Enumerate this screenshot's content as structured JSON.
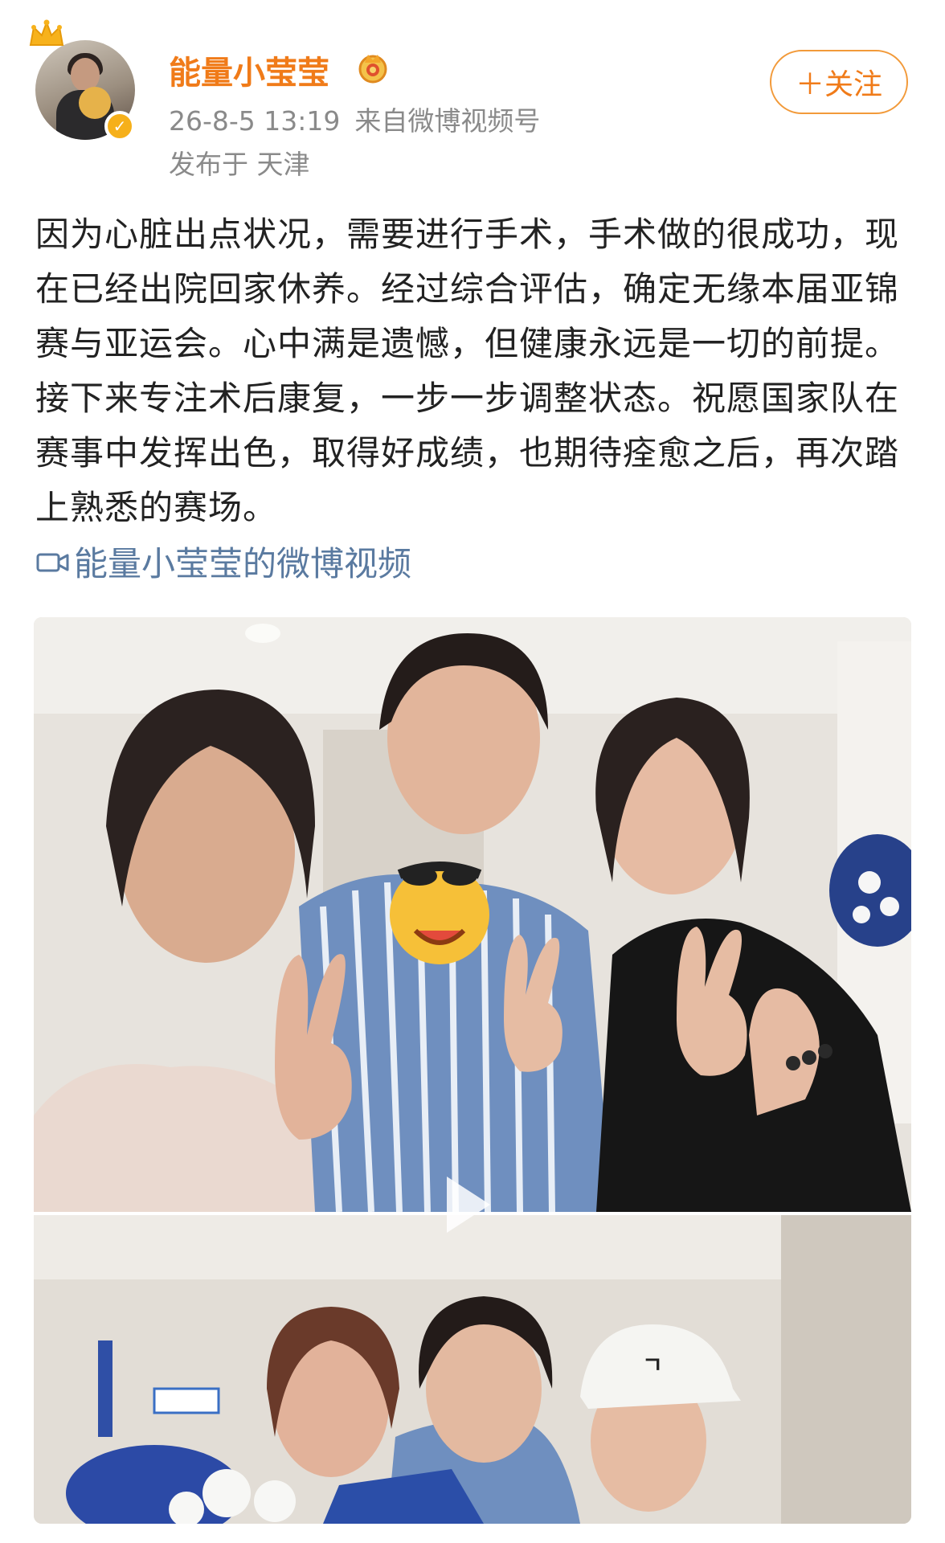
{
  "header": {
    "username": "能量小莹莹",
    "timestamp": "26-8-5 13:19",
    "source": "来自微博视频号",
    "location": "发布于 天津",
    "follow_label": "＋关注"
  },
  "post": {
    "text": "因为心脏出点状况，需要进行手术，手术做的很成功，现在已经出院回家休养。经过综合评估，确定无缘本届亚锦赛与亚运会。心中满是遗憾，但健康永远是一切的前提。接下来专注术后康复，一步一步调整状态。祝愿国家队在赛事中发挥出色，取得好成绩，也期待痊愈之后，再次踏上熟悉的赛场。",
    "video_link_label": "能量小莹莹的微博视频"
  },
  "icons": {
    "crown": "crown-icon",
    "verified": "verified-badge-icon",
    "vip": "vip-badge-icon",
    "video": "video-camera-icon",
    "play": "play-icon"
  },
  "colors": {
    "username": "#f07b19",
    "meta": "#8a8a8a",
    "link": "#5a7aa0",
    "follow_border": "#f29a3a"
  }
}
